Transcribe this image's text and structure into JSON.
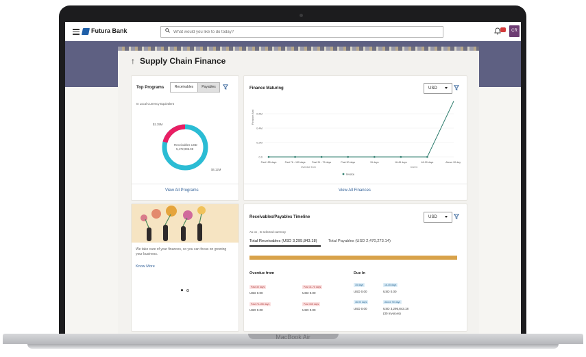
{
  "header": {
    "brand": "Futura Bank",
    "search_placeholder": "What would you like to do today?",
    "avatar_initials": "CR"
  },
  "page": {
    "title": "Supply Chain Finance"
  },
  "top_programs": {
    "title": "Top Programs",
    "tabs": [
      "Receivables",
      "Payables"
    ],
    "active_tab": "Payables",
    "currency_note": "In Local Currency Equivalent",
    "donut_center_line1": "Receivables USD",
    "donut_center_line2": "5,472,996.98",
    "label_left": "$1.35M",
    "label_right": "$4.12M",
    "colors": {
      "receivables": "#e91e63",
      "payables": "#2bbcd4"
    },
    "link": "View All Programs"
  },
  "finance_maturing": {
    "title": "Finance Maturing",
    "currency": "USD",
    "link": "View All Finances",
    "chart_data": {
      "type": "line",
      "categories": [
        "Past 155 days",
        "Past 76 - 155 days",
        "Past 31 - 75 days",
        "Past 30 days",
        "15 days",
        "16-45 days",
        "46-90 days",
        "Above 90 days"
      ],
      "series": [
        {
          "name": "Invoice",
          "values": [
            0,
            0,
            0,
            0,
            0,
            0,
            0,
            3.1
          ]
        }
      ],
      "yticks": [
        "0.0",
        "0.2M",
        "0.4M",
        "0.6M"
      ],
      "ylabel": "Finance Amt",
      "ylim": [
        0,
        3.2
      ],
      "group_labels": [
        "Overdue from",
        "Due In"
      ],
      "colors": {
        "line": "#2e7d6e"
      }
    }
  },
  "promo": {
    "text": "We take care of your finances, so you can focus on growing your business.",
    "link": "Know More"
  },
  "timeline": {
    "title": "Receivables/Payables Timeline",
    "currency": "USD",
    "as_on": "As on , In selected currency",
    "tab_receivables": "Total Receivables (USD 3,295,843.18)",
    "tab_payables": "Total Payables (USD 2,470,273.14)",
    "bar_color": "#d8a24a",
    "overdue_heading": "Overdue from",
    "duein_heading": "Due In",
    "overdue": [
      {
        "label": "Past 30 days",
        "amount": "USD 0.00"
      },
      {
        "label": "Past 31-75 days",
        "amount": "USD 0.00"
      },
      {
        "label": "Past 76-155 days",
        "amount": "USD 0.00"
      },
      {
        "label": "Past 155 days",
        "amount": "USD 0.00"
      }
    ],
    "duein": [
      {
        "label": "15 days",
        "amount": "USD 0.00",
        "note": ""
      },
      {
        "label": "16-45 days",
        "amount": "USD 0.00",
        "note": ""
      },
      {
        "label": "46-90 days",
        "amount": "USD 0.00",
        "note": ""
      },
      {
        "label": "Above 90 days",
        "amount": "USD 3,295,843.18",
        "note": "(30 Invoices)"
      }
    ]
  },
  "device": {
    "label": "MacBook Air"
  }
}
